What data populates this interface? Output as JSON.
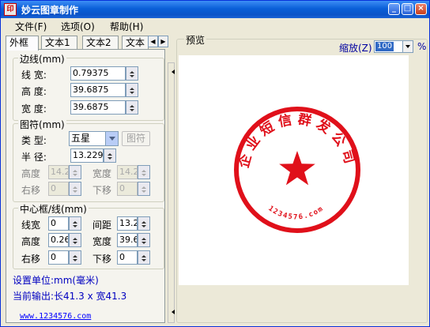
{
  "window": {
    "title": "妙云图章制作",
    "icon": "seal-app-icon"
  },
  "menu": {
    "file": "文件(F)",
    "options": "选项(O)",
    "help": "帮助(H)"
  },
  "tabs": [
    "外框",
    "文本1",
    "文本2",
    "文本"
  ],
  "border_group": {
    "legend": "边线(mm)",
    "line_width_label": "线  宽:",
    "line_width": "0.79375",
    "height_label": "高  度:",
    "height": "39.6875",
    "width_label": "宽  度:",
    "width": "39.6875"
  },
  "symbol_group": {
    "legend": "图符(mm)",
    "type_label": "类  型:",
    "type": "五星",
    "symbol_button": "图符",
    "radius_label": "半  径:",
    "radius": "13.2291",
    "height_label": "高度",
    "height": "14.2",
    "width_label": "宽度",
    "width": "14.2",
    "shift_right_label": "右移",
    "shift_right": "0",
    "shift_down_label": "下移",
    "shift_down": "0"
  },
  "center_group": {
    "legend": "中心框/线(mm)",
    "line_width_label": "线宽",
    "line_width": "0",
    "spacing_label": "间距",
    "spacing": "13.2",
    "height_label": "高度",
    "height": "0.26",
    "width_label": "宽度",
    "width": "39.6",
    "shift_right_label": "右移",
    "shift_right": "0",
    "shift_down_label": "下移",
    "shift_down": "0"
  },
  "info": {
    "unit": "设置单位:mm(毫米)",
    "output": "当前输出:长41.3 x 宽41.3"
  },
  "website": "www.1234576.com",
  "preview": {
    "legend": "预览",
    "zoom_label": "缩放(Z)",
    "zoom_value": "100",
    "zoom_unit": "%"
  },
  "stamp": {
    "color": "#e0101a",
    "top_text": "企业短信群发公司",
    "bottom_text": "1234576.com",
    "center_icon": "five-point-star"
  }
}
